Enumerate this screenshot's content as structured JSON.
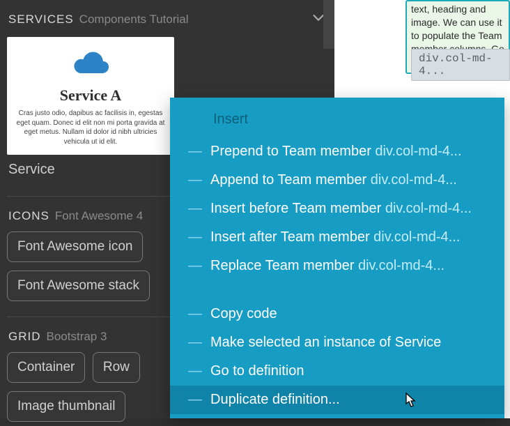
{
  "sidebar": {
    "services": {
      "title": "SERVICES",
      "subtitle": "Components Tutorial",
      "card": {
        "title": "Service A",
        "desc": "Cras justo odio, dapibus ac facilisis in, egestas eget quam. Donec id elit non mi porta gravida at eget metus. Nullam id dolor id nibh ultricies vehicula ut id elit."
      },
      "label": "Service"
    },
    "icons": {
      "title": "ICONS",
      "subtitle": "Font Awesome 4",
      "items": [
        "Font Awesome icon",
        "Font Awesome stack"
      ]
    },
    "grid": {
      "title": "GRID",
      "subtitle": "Bootstrap 3",
      "items": [
        "Container",
        "Row",
        "Image thumbnail"
      ]
    }
  },
  "hint": {
    "text": "text, heading and image. We can use it to populate the Team member columns. Go ahead and try it!"
  },
  "tag_chip": "div.col-md-4...",
  "context_menu": {
    "header": "Insert",
    "items_top": [
      {
        "label": "Prepend to Team member ",
        "suffix": "div.col-md-4..."
      },
      {
        "label": "Append to Team member ",
        "suffix": "div.col-md-4..."
      },
      {
        "label": "Insert before Team member ",
        "suffix": "div.col-md-4..."
      },
      {
        "label": "Insert after Team member ",
        "suffix": "div.col-md-4..."
      },
      {
        "label": "Replace Team member ",
        "suffix": "div.col-md-4..."
      }
    ],
    "items_bottom": [
      {
        "label": "Copy code"
      },
      {
        "label": "Make selected an instance of Service"
      },
      {
        "label": "Go to definition"
      },
      {
        "label": "Duplicate definition...",
        "hover": true
      }
    ]
  }
}
